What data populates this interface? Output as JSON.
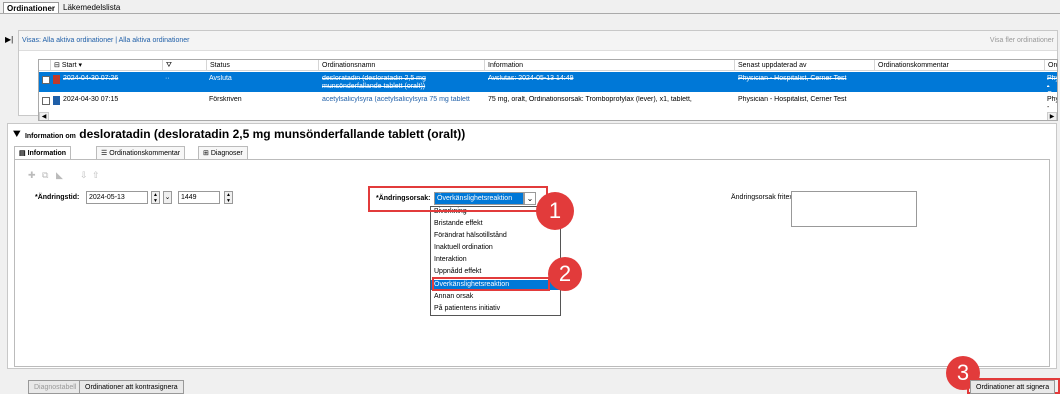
{
  "top_tabs": [
    "Ordinationer",
    "Läkemedelslista"
  ],
  "filter": {
    "links": "Visas: Alla aktiva ordinationer | Alla aktiva ordinationer",
    "right": "Visa fler ordinationer"
  },
  "columns": [
    "Start",
    "Status",
    "Ordinationsnamn",
    "Information",
    "Senast uppdaterad av",
    "Ordinationskommentar",
    "Ordineranc"
  ],
  "rows": [
    {
      "start": "2024-04-30 07:26",
      "status": "Avsluta",
      "name": "desloratadin (desloratadin 2,5 mg munsönderfallande tablett (oralt))",
      "info": "Avslutas: 2024-05-13 14:49",
      "by": "Physician - Hospitalist, Cerner Test",
      "comment": "",
      "ord": "Physician - Cerner Test"
    },
    {
      "start": "2024-04-30 07:15",
      "status": "Förskriven",
      "name": "acetylsalicylsyra (acetylsalicylsyra 75 mg tablett",
      "info": "75 mg, oralt, Ordinationsorsak: Tromboprofylax (lever), x1, tablett,",
      "by": "Physician - Hospitalist, Cerner Test",
      "comment": "",
      "ord": "Physician -"
    }
  ],
  "info_panel": {
    "prefix": "Information om",
    "title": "desloratadin (desloratadin 2,5 mg munsönderfallande tablett (oralt))",
    "tabs": [
      "Information",
      "Ordinationskommentar",
      "Diagnoser"
    ]
  },
  "form": {
    "change_time_label": "*Ändringstid:",
    "change_date": "2024-05-13",
    "change_time": "1449",
    "reason_label": "*Ändringsorsak:",
    "reason_value": "Överkänslighetsreaktion",
    "reason_free_label": "Ändringsorsak fritext:"
  },
  "dropdown_options": [
    "Biverkning",
    "Bristande effekt",
    "Förändrat hälsotillstånd",
    "Inaktuell ordination",
    "Interaktion",
    "Uppnådd effekt",
    "Överkänslighetsreaktion",
    "Annan orsak",
    "På patientens initiativ"
  ],
  "dropdown_selected_index": 6,
  "callouts": [
    "1",
    "2",
    "3"
  ],
  "buttons": {
    "diag": "Diagnostabell",
    "cosign": "Ordinationer att kontrasignera",
    "sign": "Ordinationer att signera"
  },
  "colors": {
    "selection": "#0078d7",
    "callout": "#e23b3b",
    "link": "#1f5fa8"
  }
}
